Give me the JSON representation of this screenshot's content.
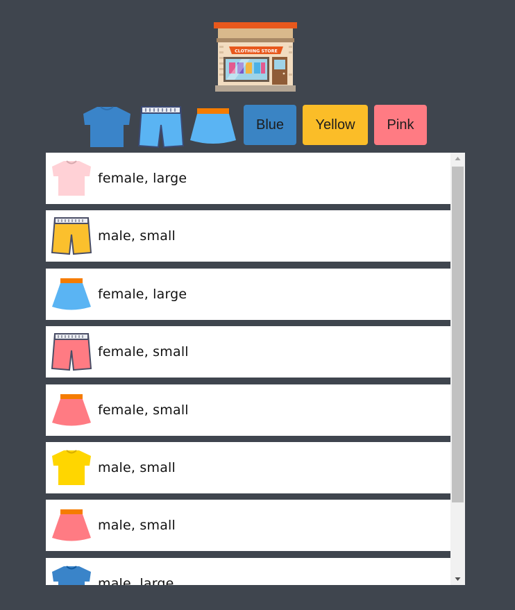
{
  "store": {
    "sign_text": "CLOTHING STORE",
    "icon": "clothing-store-icon"
  },
  "filters": {
    "type_icons": [
      {
        "icon": "tshirt-icon",
        "color": "#3a84c9"
      },
      {
        "icon": "shorts-icon",
        "color": "#5ab4f3"
      },
      {
        "icon": "skirt-icon",
        "color": "#5ab4f3"
      }
    ],
    "colors": [
      {
        "label": "Blue",
        "bg": "#3a84c4"
      },
      {
        "label": "Yellow",
        "bg": "#fbbd28"
      },
      {
        "label": "Pink",
        "bg": "#ff7b83"
      }
    ]
  },
  "items": [
    {
      "type": "tshirt",
      "icon": "tshirt-icon",
      "color": "#ffd1d6",
      "text": "female, large"
    },
    {
      "type": "shorts",
      "icon": "shorts-icon",
      "color": "#fbc02d",
      "text": "male, small"
    },
    {
      "type": "skirt",
      "icon": "skirt-icon",
      "color": "#5ab4f3",
      "text": "female, large"
    },
    {
      "type": "shorts",
      "icon": "shorts-icon",
      "color": "#ff7b83",
      "text": "female, small"
    },
    {
      "type": "skirt",
      "icon": "skirt-icon",
      "color": "#ff7b83",
      "text": "female, small"
    },
    {
      "type": "tshirt",
      "icon": "tshirt-icon",
      "color": "#ffd600",
      "text": "male, small"
    },
    {
      "type": "skirt",
      "icon": "skirt-icon",
      "color": "#ff7b83",
      "text": "male, small"
    },
    {
      "type": "tshirt",
      "icon": "tshirt-icon",
      "color": "#3a84c9",
      "text": "male, large"
    }
  ]
}
